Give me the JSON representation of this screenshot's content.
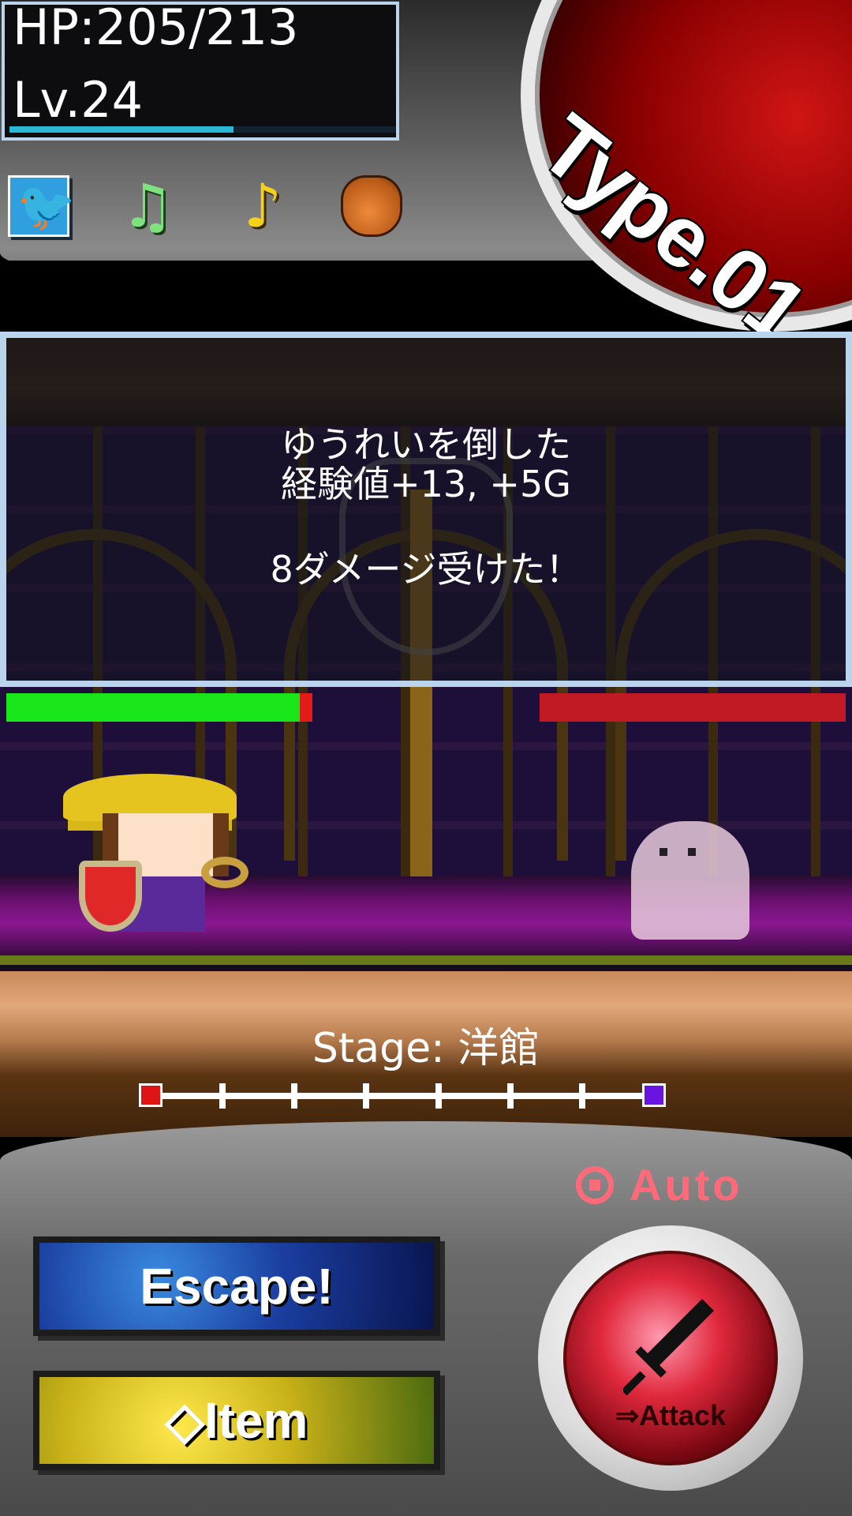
{
  "status": {
    "hp_text": "HP:205/213",
    "level_text": "Lv.24",
    "exp_progress": 0.58
  },
  "toolbar": {
    "icons": [
      "twitter-icon",
      "music-icon",
      "sound-effect-icon",
      "item-bag-icon"
    ],
    "music_glyph": "♫",
    "se_glyph": "♪",
    "twitter_glyph": "🐦"
  },
  "type_badge": "Type.01",
  "battle_log": {
    "line1": "ゆうれいを倒した",
    "line2": "経験値+13, +5G",
    "line3": "8ダメージ受けた！"
  },
  "player_hp_ratio": 0.96,
  "enemy_hp_ratio": 1.0,
  "stage": {
    "label": "Stage: 洋館",
    "segments": 7,
    "current_position": 0
  },
  "controls": {
    "auto_label": "Auto",
    "escape_label": "Escape!",
    "item_label": "◇Item",
    "attack_label": "⇒Attack"
  },
  "colors": {
    "player_hp": "#19e619",
    "enemy_hp": "#c21a24",
    "auto": "#ff6a7a",
    "frame": "#b9d4ec"
  }
}
